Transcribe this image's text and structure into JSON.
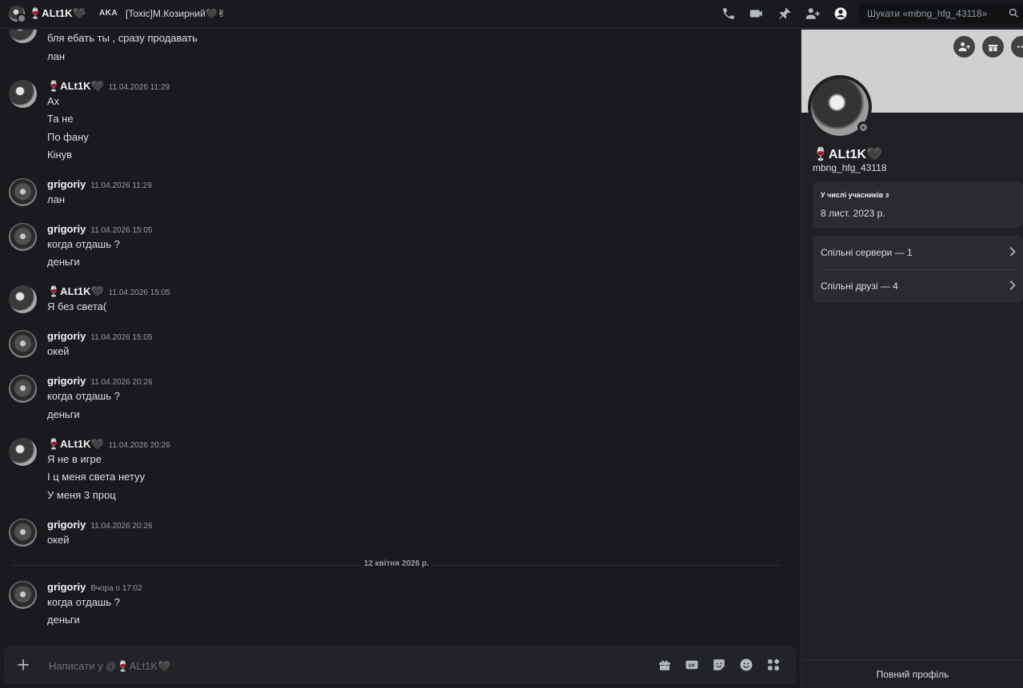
{
  "header": {
    "dm_name": "🍷ALt1K🖤",
    "aka_label": "AKA",
    "aka_value": "[Toxic]М.Козирний🖤✌",
    "search_placeholder": "Шукати «mbng_hfg_43118»",
    "icons": [
      "phone-icon",
      "video-icon",
      "pin-icon",
      "add-member-icon",
      "profile-icon",
      "search-icon"
    ]
  },
  "messages": [
    {
      "author": "",
      "time": "",
      "lines": [
        "бля ебать ты , сразу продавать",
        "лан"
      ]
    },
    {
      "author": "🍷ALt1K🖤",
      "time": "11.04.2026 11:29",
      "lines": [
        "Ах",
        "Та не",
        "По фану",
        "Кінув"
      ]
    },
    {
      "author": "grigoriy",
      "time": "11.04.2026 11:29",
      "lines": [
        "лан"
      ]
    },
    {
      "author": "grigoriy",
      "time": "11.04.2026 15:05",
      "lines": [
        "когда отдашь ?",
        "деньги"
      ]
    },
    {
      "author": "🍷ALt1K🖤",
      "time": "11.04.2026 15:05",
      "lines": [
        "Я без света("
      ]
    },
    {
      "author": "grigoriy",
      "time": "11.04.2026 15:05",
      "lines": [
        "окей"
      ]
    },
    {
      "author": "grigoriy",
      "time": "11.04.2026 20:26",
      "lines": [
        "когда отдашь ?",
        "деньги"
      ]
    },
    {
      "author": "🍷ALt1K🖤",
      "time": "11.04.2026 20:26",
      "lines": [
        "Я не в игре",
        "І ц меня света нетуу",
        "У меня 3 проц"
      ]
    },
    {
      "author": "grigoriy",
      "time": "11.04.2026 20:26",
      "lines": [
        "окей"
      ]
    },
    {
      "author": "grigoriy",
      "time": "Вчора о 17:02",
      "lines": [
        "когда отдашь ?",
        "деньги"
      ]
    }
  ],
  "date_divider": "12 квітня 2026 р.",
  "composer": {
    "placeholder": "Написати у @🍷ALt1K🖤",
    "icons": [
      "gift-icon",
      "gif-icon",
      "sticker-icon",
      "emoji-icon",
      "apps-icon"
    ]
  },
  "profile": {
    "display_name": "🍷ALt1K🖤",
    "username": "mbng_hfg_43118",
    "member_since_label": "У числі учасників з",
    "member_since_value": "8 лист. 2023 р.",
    "mutual_servers": "Спільні сервери — 1",
    "mutual_friends": "Спільні друзі — 4",
    "full_profile": "Повний профіль"
  }
}
